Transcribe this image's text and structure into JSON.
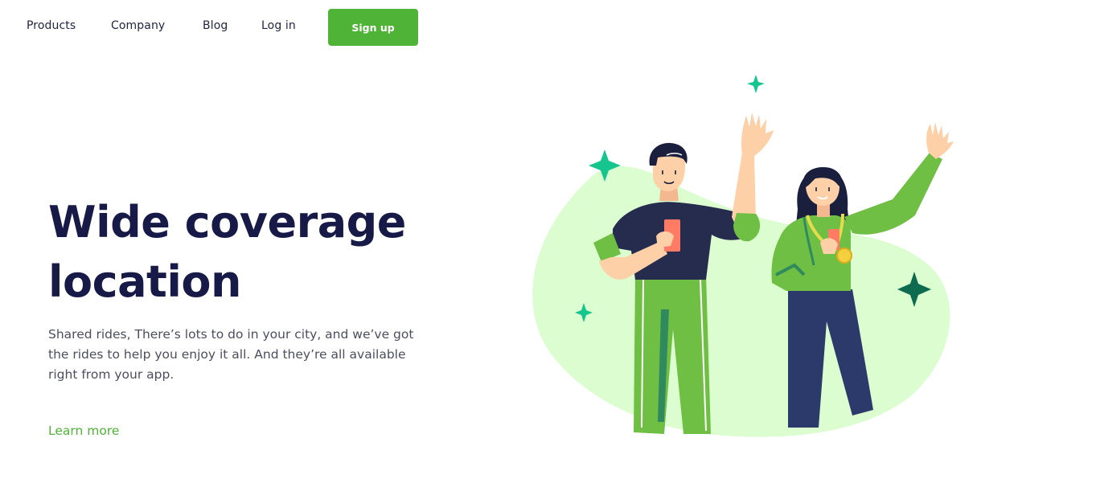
{
  "nav": {
    "products": "Products",
    "company": "Company",
    "blog": "Blog",
    "login": "Log in",
    "signup": "Sign up"
  },
  "hero": {
    "title_line1": "Wide coverage",
    "title_line2": "location",
    "description": "Shared rides, There’s lots to do in your city, and we’ve got the rides to help you enjoy it all. And they’re all available right from your app.",
    "cta": "Learn more"
  },
  "colors": {
    "brand_green": "#4fb338",
    "heading_navy": "#171a47",
    "blob_green": "#dbfdd0",
    "sparkle_teal": "#14c68e",
    "sparkle_dark": "#0d6b4f"
  },
  "icons": [
    "sparkle-icon"
  ]
}
